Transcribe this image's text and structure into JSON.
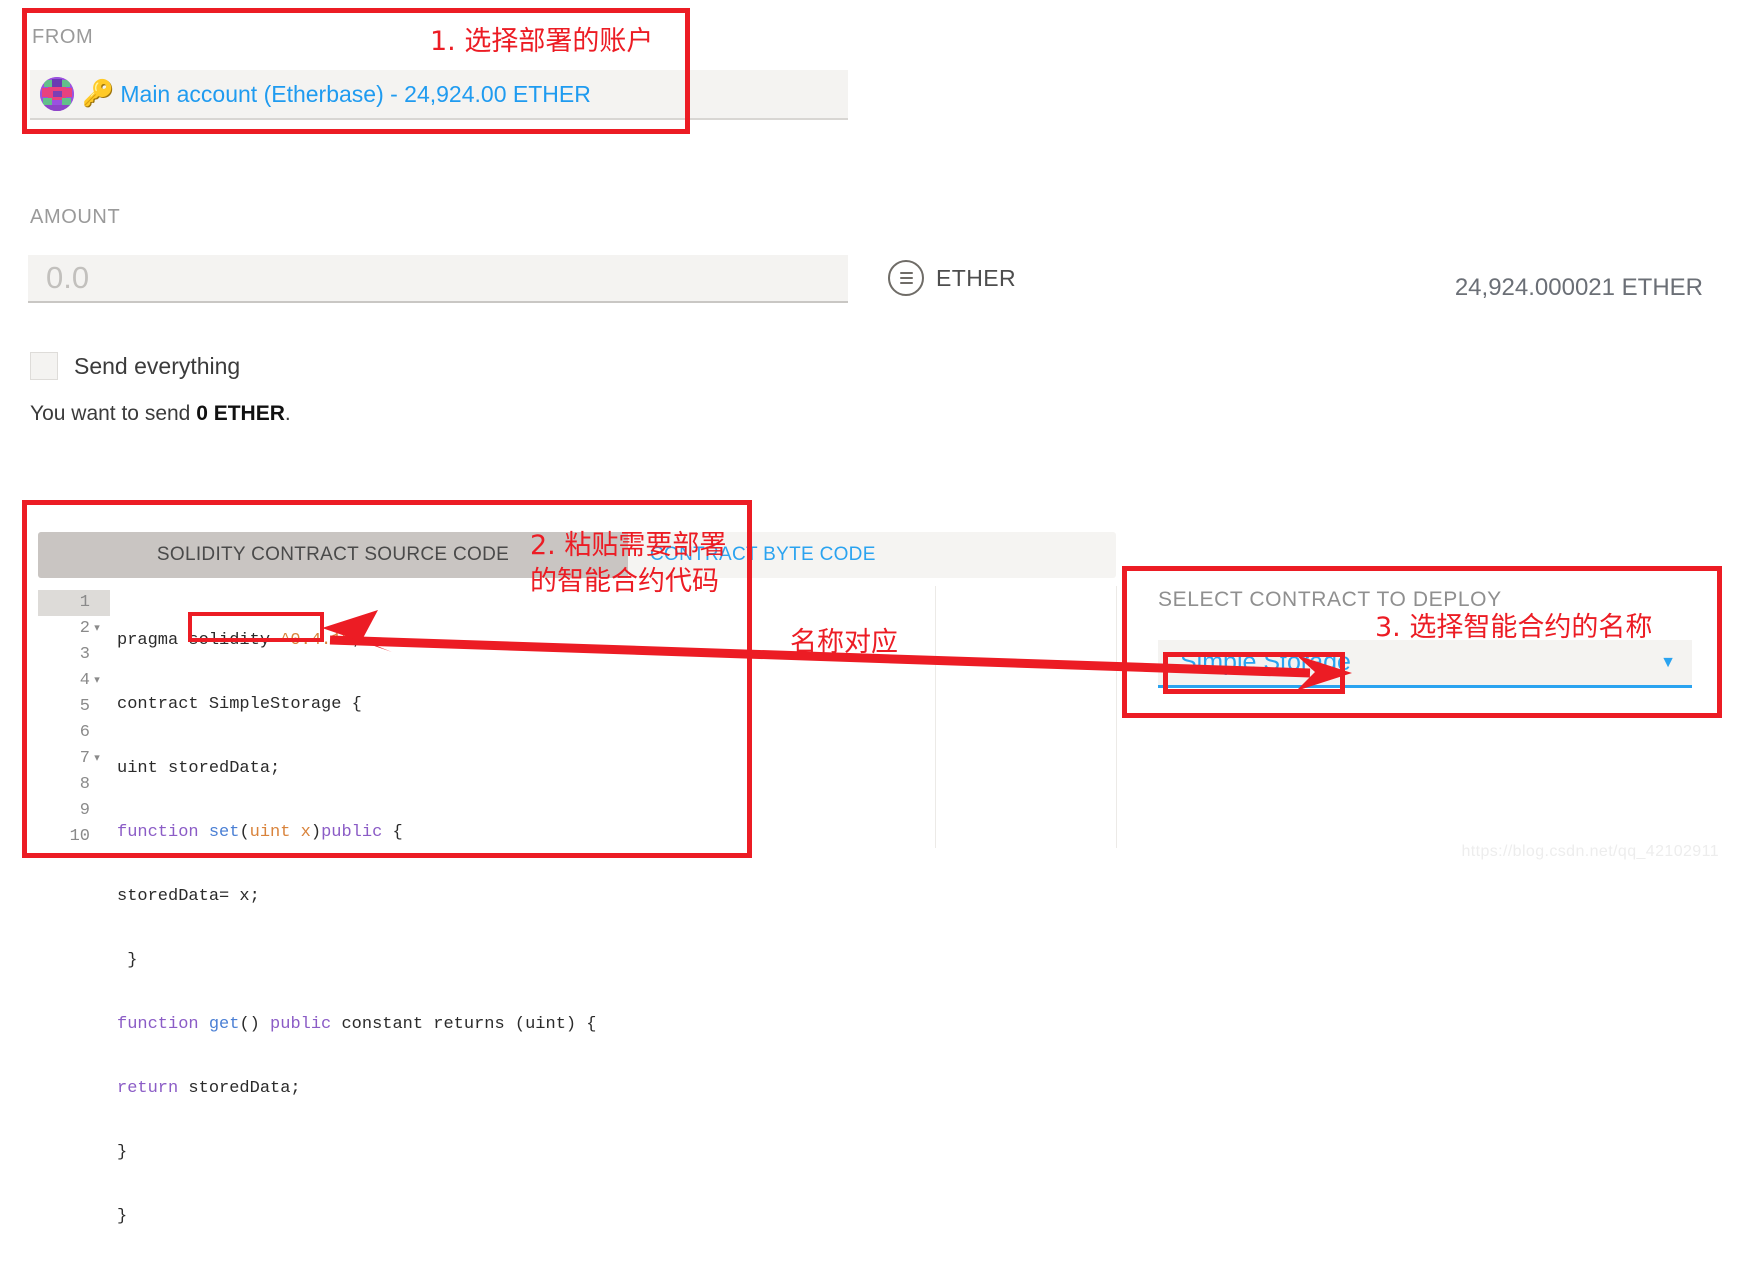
{
  "from": {
    "label": "FROM",
    "account_icon": "key-icon",
    "account_text": "Main account (Etherbase) - 24,924.00 ETHER"
  },
  "amount": {
    "label": "AMOUNT",
    "input_value": "",
    "input_placeholder": "0.0",
    "unit_icon": "ether-unit-icon",
    "unit_label": "ETHER",
    "balance": "24,924.000021 ETHER",
    "send_everything_label": "Send everything",
    "send_everything_checked": false,
    "summary_prefix": "You want to send ",
    "summary_amount": "0 ETHER",
    "summary_suffix": "."
  },
  "code_panel": {
    "tabs": [
      {
        "label": "SOLIDITY CONTRACT SOURCE CODE",
        "active": true
      },
      {
        "label": "CONTRACT BYTE CODE",
        "active": false
      }
    ],
    "gutter": [
      {
        "num": "1",
        "fold": "",
        "active": true
      },
      {
        "num": "2",
        "fold": "▾",
        "active": false
      },
      {
        "num": "3",
        "fold": "",
        "active": false
      },
      {
        "num": "4",
        "fold": "▾",
        "active": false
      },
      {
        "num": "5",
        "fold": "",
        "active": false
      },
      {
        "num": "6",
        "fold": "",
        "active": false
      },
      {
        "num": "7",
        "fold": "▾",
        "active": false
      },
      {
        "num": "8",
        "fold": "",
        "active": false
      },
      {
        "num": "9",
        "fold": "",
        "active": false
      },
      {
        "num": "10",
        "fold": "",
        "active": false
      }
    ],
    "source_lines": [
      "pragma solidity ^0.4.18;",
      "contract SimpleStorage {",
      "uint storedData;",
      "function set(uint x)public {",
      "storedData= x;",
      " }",
      "function get() public constant returns (uint) {",
      "return storedData;",
      "}",
      "}"
    ]
  },
  "select_contract": {
    "label": "SELECT CONTRACT TO DEPLOY",
    "value": "Simple Storage",
    "caret_icon": "chevron-down-icon"
  },
  "annotations": {
    "step1": "1. 选择部署的账户",
    "step2_line1": "2. 粘贴需要部署",
    "step2_line2": "的智能合约代码",
    "step3": "3. 选择智能合约的名称",
    "mapping": "名称对应"
  },
  "watermark": "https://blog.csdn.net/qq_42102911",
  "colors": {
    "annotation_red": "#ec1c24",
    "link_blue": "#2aa3f0",
    "account_blue": "#1f9bf0",
    "muted_gray": "#9a9a9a",
    "field_bg": "#f4f3f1",
    "active_tab_bg": "#c9c5c2"
  }
}
